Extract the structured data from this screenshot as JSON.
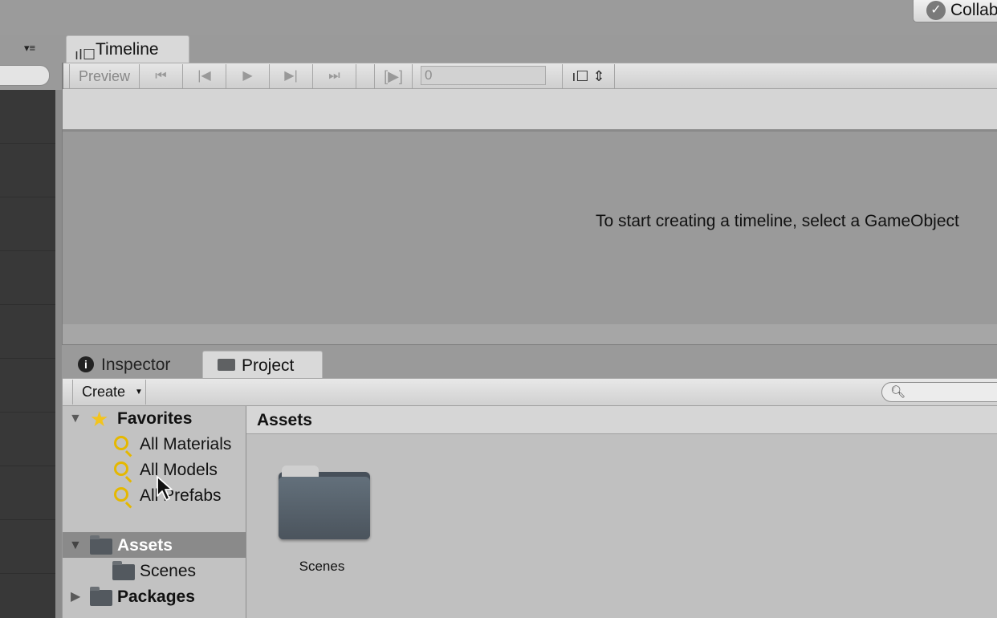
{
  "topbar": {
    "collab_label": "Collab"
  },
  "timeline": {
    "tab_label": "Timeline",
    "preview_label": "Preview",
    "frame_value": "0",
    "empty_message": "To start creating a timeline, select a GameObject"
  },
  "dock": {
    "inspector_tab": "Inspector",
    "project_tab": "Project"
  },
  "project": {
    "create_label": "Create",
    "search_placeholder": "",
    "tree": {
      "favorites_label": "Favorites",
      "favorites_items": [
        "All Materials",
        "All Models",
        "All Prefabs"
      ],
      "assets_label": "Assets",
      "assets_children": [
        "Scenes"
      ],
      "packages_label": "Packages"
    },
    "grid_header": "Assets",
    "grid_items": [
      "Scenes"
    ]
  },
  "icons": {
    "collab": "check-circle-icon",
    "timeline": "timeline-icon",
    "inspector": "info-icon",
    "project": "folder-icon",
    "favorites": "star-icon",
    "search_filter": "magnifier-icon"
  },
  "colors": {
    "selected_row": "#8a8a8a",
    "star": "#f3c41d",
    "folder": "#53595f"
  }
}
